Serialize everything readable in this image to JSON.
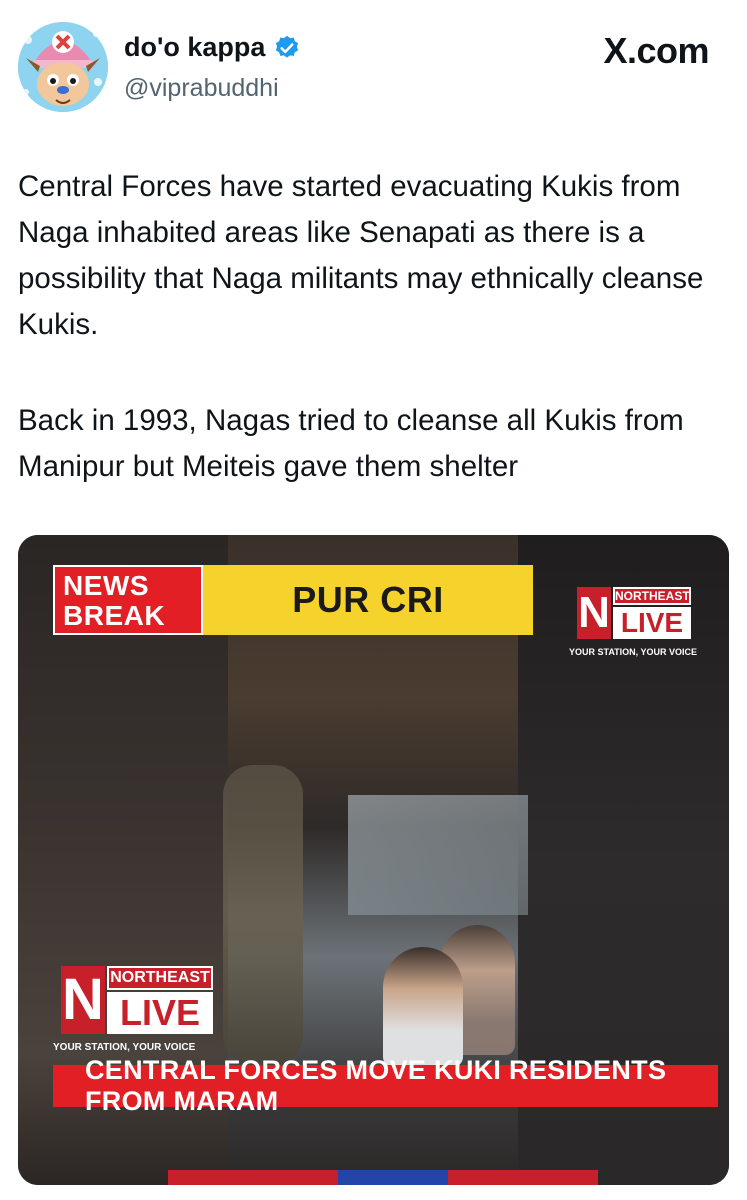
{
  "author": {
    "display_name": "do'o kappa",
    "handle": "@viprabuddhi",
    "verified": true,
    "avatar_icon": "chopper-avatar-icon"
  },
  "brand": {
    "label": "X.com"
  },
  "tweet": {
    "paragraphs": [
      "Central Forces have started evacuating Kukis from Naga inhabited areas like Senapati as there is a possibility that Naga militants may ethnically cleanse Kukis.",
      "Back in 1993, Nagas tried to cleanse all Kukis from Manipur but Meiteis gave them shelter"
    ]
  },
  "media": {
    "news_break_line1": "NEWS",
    "news_break_line2": "BREAK",
    "headline_partial": "PUR CRI",
    "logo_top": {
      "small": "NORTHEAST",
      "big": "LIVE",
      "tagline": "YOUR STATION, YOUR VOICE"
    },
    "logo_bottom": {
      "small": "NORTHEAST",
      "big": "LIVE",
      "tagline": "YOUR STATION, YOUR VOICE"
    },
    "ticker": "CENTRAL FORCES MOVE KUKI RESIDENTS FROM MARAM"
  },
  "colors": {
    "accent_red": "#e11f24",
    "headline_yellow": "#f5d32c",
    "verified_blue": "#1d9bf0"
  }
}
